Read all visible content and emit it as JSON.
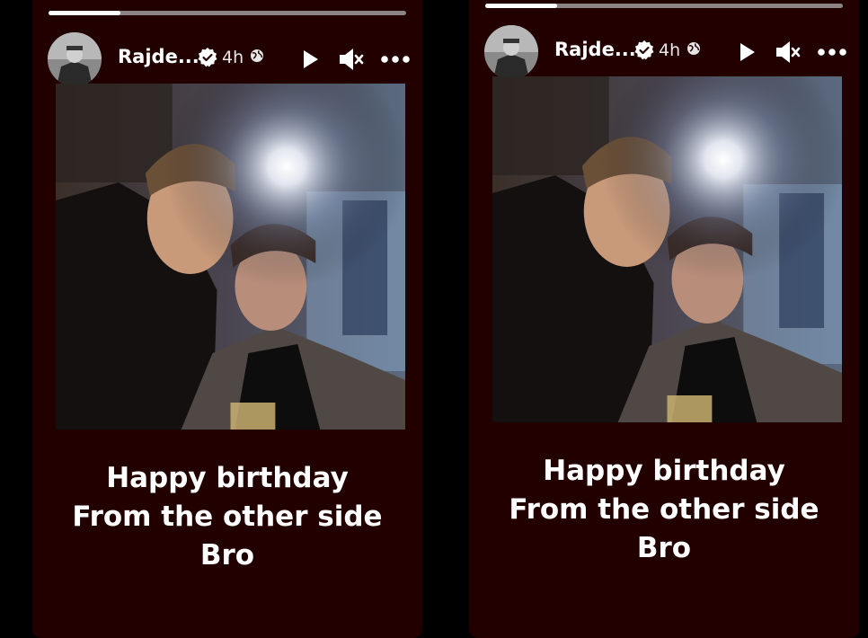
{
  "stories": [
    {
      "username": "Rajde...",
      "time": "4h",
      "progress": 0.2,
      "caption": [
        "Happy birthday",
        "From the other side",
        "Bro"
      ],
      "icons": [
        "verified-badge-icon",
        "globe-icon",
        "play-icon",
        "mute-icon",
        "more-icon"
      ]
    },
    {
      "username": "Rajde...",
      "time": "4h",
      "progress": 0.2,
      "caption": [
        "Happy birthday",
        "From the other side",
        "Bro"
      ],
      "icons": [
        "verified-badge-icon",
        "globe-icon",
        "play-icon",
        "mute-icon",
        "more-icon"
      ]
    }
  ],
  "colors": {
    "background": "#000000",
    "story_bg": "#220000",
    "text": "#ffffff",
    "progress_track": "#8c8484"
  }
}
